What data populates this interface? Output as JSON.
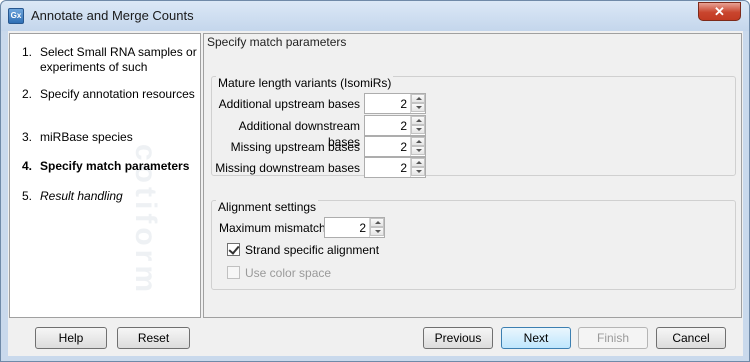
{
  "window": {
    "title": "Annotate and Merge Counts",
    "app_icon_text": "Gx",
    "close_label": "✕"
  },
  "steps": [
    {
      "num": "1.",
      "label": "Select Small RNA samples or experiments of such",
      "state": "done"
    },
    {
      "num": "2.",
      "label": "Specify annotation resources",
      "state": "done"
    },
    {
      "num": "3.",
      "label": "miRBase species",
      "state": "done"
    },
    {
      "num": "4.",
      "label": "Specify match parameters",
      "state": "current"
    },
    {
      "num": "5.",
      "label": "Result handling",
      "state": "future"
    }
  ],
  "watermark": "cotiform",
  "main": {
    "title": "Specify match parameters",
    "isomirs": {
      "title": "Mature length variants (IsomiRs)",
      "fields": [
        {
          "label": "Additional upstream bases",
          "value": "2"
        },
        {
          "label": "Additional downstream bases",
          "value": "2"
        },
        {
          "label": "Missing upstream bases",
          "value": "2"
        },
        {
          "label": "Missing downstream bases",
          "value": "2"
        }
      ]
    },
    "alignment": {
      "title": "Alignment settings",
      "max_mismatches_label": "Maximum mismatches",
      "max_mismatches_value": "2",
      "strand_specific_label": "Strand specific alignment",
      "strand_specific_checked": true,
      "color_space_label": "Use color space",
      "color_space_checked": false,
      "color_space_enabled": false
    }
  },
  "buttons": {
    "help": "Help",
    "reset": "Reset",
    "previous": "Previous",
    "next": "Next",
    "finish": "Finish",
    "cancel": "Cancel"
  }
}
